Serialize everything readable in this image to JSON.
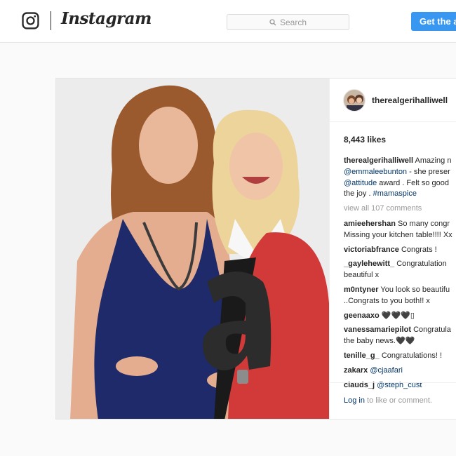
{
  "header": {
    "brand": "Instagram",
    "search_placeholder": "Search",
    "cta_label": "Get the app"
  },
  "post": {
    "username": "therealgerihalliwell",
    "likes": "8,443 likes",
    "caption": {
      "user": "therealgerihalliwell",
      "line1": "Amazing n",
      "mention1": "@emmaleebunton",
      "line2": " - she preser",
      "mention2": "@attitude",
      "line3": " award . Felt so good",
      "line4": "the joy . ",
      "hashtag": "#mamaspice"
    },
    "view_all": "view all 107 comments",
    "comments": [
      {
        "user": "amieehershan",
        "l1": "So many congr",
        "l2": "Missing your kitchen table!!!! Xx"
      },
      {
        "user": "victoriabfrance",
        "l1": "Congrats !"
      },
      {
        "user": "_gaylehewitt_",
        "l1": "Congratulation",
        "l2": "beautiful x"
      },
      {
        "user": "m0ntyner",
        "l1": "You look so beautifu",
        "l2": "..Congrats to you both!! x"
      },
      {
        "user": "geenaaxo",
        "l1": "🖤🖤🖤▯"
      },
      {
        "user": "vanessamariepilot",
        "l1": "Congratula",
        "l2": "the baby news.🖤🖤"
      },
      {
        "user": "tenille_g_",
        "l1": "Congratulations! !"
      },
      {
        "user": "zakarx",
        "mention": "@cjaafari"
      },
      {
        "user": "clauds_j",
        "mention": "@steph_cust"
      }
    ],
    "login_link": "Log in",
    "login_text": " to like or comment."
  },
  "icons": {
    "brand_glyph": "instagram-camera-icon",
    "search": "magnifier-icon"
  },
  "colors": {
    "cta_blue": "#3897f0",
    "link_navy": "#003569",
    "muted_gray": "#999999",
    "border": "#e6e6e6"
  }
}
